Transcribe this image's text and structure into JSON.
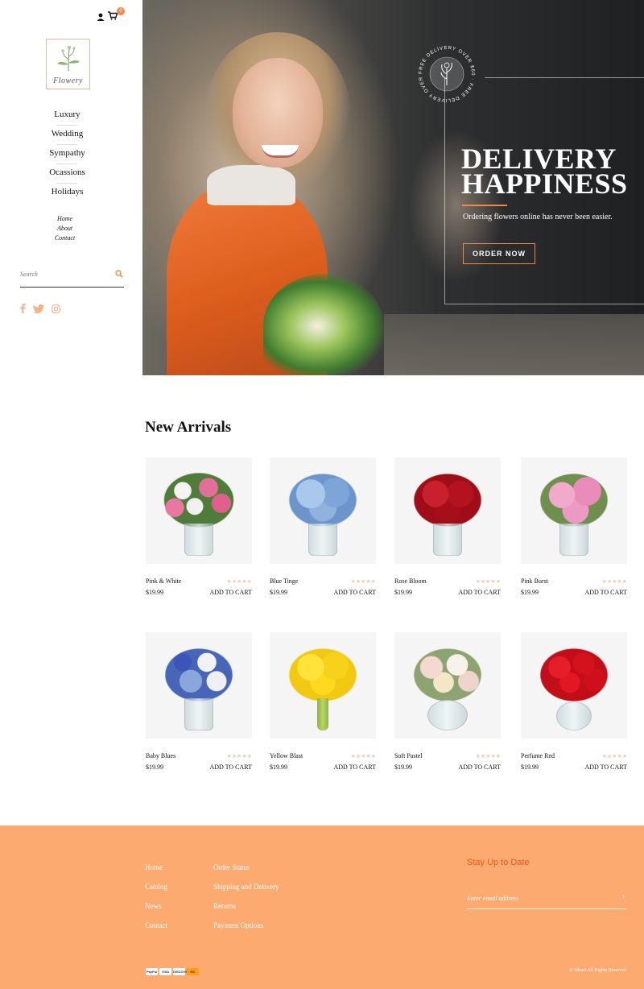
{
  "sidebar": {
    "cart_count": "0",
    "logo_text": "Flowery",
    "categories": [
      "Luxury",
      "Wedding",
      "Sympathy",
      "Ocassions",
      "Holidays"
    ],
    "links": [
      "Home",
      "About",
      "Contact"
    ],
    "search_placeholder": "Search"
  },
  "hero": {
    "badge_text": "FREE DELIVERY OVER $60 · FREE DELIVERY OVER $60 · ",
    "title": "DELIVERY\nHAPPINESS",
    "subtitle": "Ordering flowers online has never been easier.",
    "button": "ORDER NOW"
  },
  "arrivals": {
    "title": "New Arrivals",
    "stars": "★★★★★",
    "cart_label": "ADD TO CART",
    "products": [
      {
        "name": "Pink & White",
        "price": "$19.99"
      },
      {
        "name": "Blue Tinge",
        "price": "$19.99"
      },
      {
        "name": "Rose Bloom",
        "price": "$19.99"
      },
      {
        "name": "Pink Burst",
        "price": "$19.99"
      },
      {
        "name": "Baby Blues",
        "price": "$19.99"
      },
      {
        "name": "Yellow Blast",
        "price": "$19.99"
      },
      {
        "name": "Soft Pastel",
        "price": "$19.99"
      },
      {
        "name": "Perfume Red",
        "price": "$19.99"
      }
    ]
  },
  "footer": {
    "col1": [
      "Home",
      "Catalog",
      "News",
      "Contact"
    ],
    "col2": [
      "Order Status",
      "Shipping and Delivery",
      "Returns",
      "Payment Options"
    ],
    "newsletter_title": "Stay Up to Date",
    "email_placeholder": "Enter email address",
    "payments": [
      "PayPal",
      "VISA",
      "DISCOVER",
      "MC"
    ],
    "copyright": "© 2dcart All Rights Reserved"
  },
  "colors": {
    "accent": "#f2874b",
    "footer_bg": "#fcaa70",
    "footer_heading": "#e8591c"
  }
}
